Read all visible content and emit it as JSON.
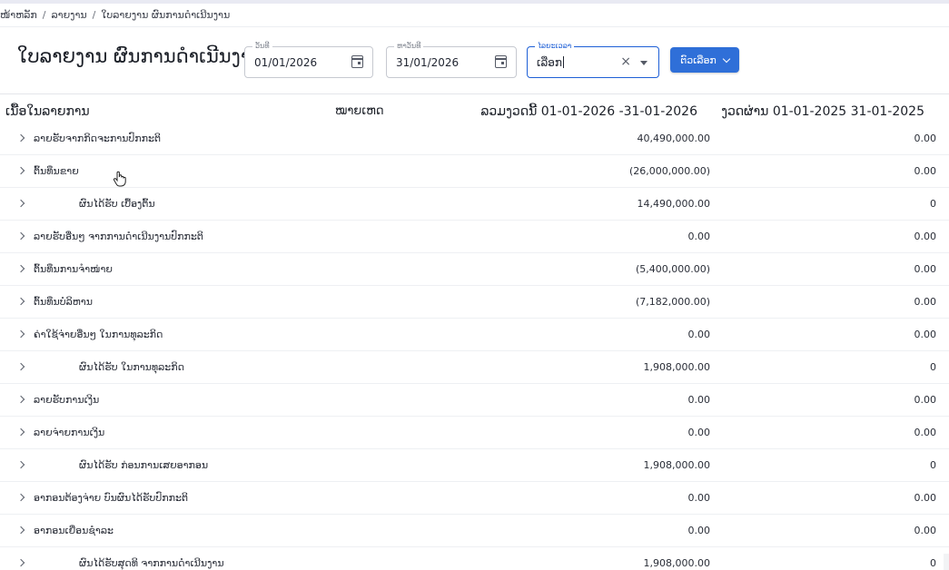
{
  "breadcrumb": [
    "ໜ້າຫລັກ",
    "ລາຍງານ",
    "ໃບລາຍງານ ຜົນການດຳເນີນງານ"
  ],
  "page_title": "ໃບລາຍງານ ຜົນການດຳເນີນງານ",
  "filters": {
    "from": {
      "label": "ວັນທີ",
      "value": "01/01/2026"
    },
    "to": {
      "label": "ຫາວັນທີ",
      "value": "31/01/2026"
    },
    "period": {
      "label": "ໄລຍະເວລາ",
      "value": "ເລືອກ"
    },
    "options_label": "ຕົວເລືອກ"
  },
  "columns": {
    "description": "ເນື້ອໃນລາຍການ",
    "note": "ໝາຍເຫດ",
    "current": "ລວມງວດນີ້ 01-01-2026 -31-01-2026",
    "previous": "ງວດຜ່ານ 01-01-2025 31-01-2025"
  },
  "rows": [
    {
      "label": "ລາຍຮັບຈາກກິດຈະການປົກກະຕິ",
      "current": "40,490,000.00",
      "previous": "0.00",
      "sub": false
    },
    {
      "label": "ຕົ້ນທຶນຂາຍ",
      "current": "(26,000,000.00)",
      "previous": "0.00",
      "sub": false
    },
    {
      "label": "ຜົນໄດ້ຮັບ ເບື້ອງຕົ້ນ",
      "current": "14,490,000.00",
      "previous": "0",
      "sub": true
    },
    {
      "label": "ລາຍຮັບອື່ນໆ ຈາກການດຳເນີນງານປົກກະຕິ",
      "current": "0.00",
      "previous": "0.00",
      "sub": false
    },
    {
      "label": "ຕົ້ນທຶນການຈຳໜ່າຍ",
      "current": "(5,400,000.00)",
      "previous": "0.00",
      "sub": false
    },
    {
      "label": "ຕົ້ນທຶນບໍລິຫານ",
      "current": "(7,182,000.00)",
      "previous": "0.00",
      "sub": false
    },
    {
      "label": "ຄ່າໃຊ້ຈ່າຍອື່ນໆ ໃນການທຸລະກິດ",
      "current": "0.00",
      "previous": "0.00",
      "sub": false
    },
    {
      "label": "ຜົນໄດ້ຮັບ ໃນການທຸລະກິດ",
      "current": "1,908,000.00",
      "previous": "0",
      "sub": true
    },
    {
      "label": "ລາຍຮັບການເງິນ",
      "current": "0.00",
      "previous": "0.00",
      "sub": false
    },
    {
      "label": "ລາຍຈ່າຍການເງິນ",
      "current": "0.00",
      "previous": "0.00",
      "sub": false
    },
    {
      "label": "ຜົນໄດ້ຮັບ ກ່ອນການເສຍອາກອນ",
      "current": "1,908,000.00",
      "previous": "0",
      "sub": true
    },
    {
      "label": "ອາກອນຕ້ອງຈ່າຍ ບົນຜົນໄດ້ຮັບປົກກະຕິ",
      "current": "0.00",
      "previous": "0.00",
      "sub": false
    },
    {
      "label": "ອາກອນເຍື່ອນຊຳລະ",
      "current": "0.00",
      "previous": "0.00",
      "sub": false
    },
    {
      "label": "ຜົນໄດ້ຮັບສຸດທິ ຈາກການດຳເນີນງານ",
      "current": "1,908,000.00",
      "previous": "0",
      "sub": true
    }
  ]
}
